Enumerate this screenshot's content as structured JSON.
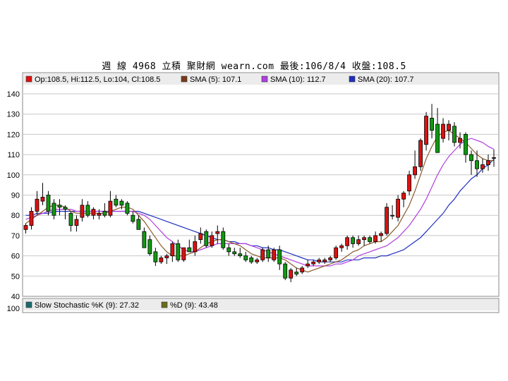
{
  "title": "週 線 4968 立積    聚財網 wearn.com    最後:106/8/4 收盤:108.5",
  "price_legend": [
    {
      "text": "Op:108.5, Hi:112.5, Lo:104, Cl:108.5",
      "color": "#dd1111"
    },
    {
      "text": "SMA (5): 107.1",
      "color": "#7a3a1a"
    },
    {
      "text": "SMA (10): 112.7",
      "color": "#b040e0"
    },
    {
      "text": "SMA (20): 107.7",
      "color": "#2030c0"
    }
  ],
  "stoch_legend": [
    {
      "text": "Slow Stochastic %K (9): 27.32",
      "color": "#1a6b6b"
    },
    {
      "text": "%D (9): 43.48",
      "color": "#6b6b1a"
    }
  ],
  "colors": {
    "up": "#dd1111",
    "down": "#119911",
    "sma5": "#8b5a2b",
    "sma10": "#b040e0",
    "sma20": "#2030c0",
    "grid": "#c8c8c8"
  },
  "chart_data": {
    "type": "candlestick",
    "ylim": [
      40,
      140
    ],
    "yticks": [
      40,
      50,
      60,
      70,
      80,
      90,
      100,
      110,
      120,
      130,
      140
    ],
    "lower_panel_ticks": [
      100
    ],
    "candles": [
      [
        73,
        76,
        71,
        75
      ],
      [
        75,
        84,
        73,
        82
      ],
      [
        82,
        92,
        80,
        88
      ],
      [
        87,
        96,
        85,
        89
      ],
      [
        90,
        92,
        80,
        82
      ],
      [
        86,
        88,
        78,
        80
      ],
      [
        85,
        88,
        80,
        84
      ],
      [
        84,
        85,
        78,
        83
      ],
      [
        81,
        82,
        72,
        75
      ],
      [
        75,
        80,
        72,
        78
      ],
      [
        79,
        88,
        77,
        85
      ],
      [
        85,
        87,
        79,
        80
      ],
      [
        80,
        84,
        78,
        83
      ],
      [
        80,
        83,
        78,
        81
      ],
      [
        82,
        86,
        79,
        80
      ],
      [
        80,
        92,
        79,
        87
      ],
      [
        88,
        90,
        84,
        85
      ],
      [
        87,
        88,
        83,
        85
      ],
      [
        86,
        87,
        80,
        81
      ],
      [
        80,
        82,
        76,
        77
      ],
      [
        78,
        80,
        73,
        73
      ],
      [
        72,
        74,
        64,
        64
      ],
      [
        68,
        70,
        60,
        61
      ],
      [
        62,
        64,
        55,
        57
      ],
      [
        57,
        60,
        56,
        59
      ],
      [
        59,
        61,
        56,
        60
      ],
      [
        60,
        67,
        57,
        66
      ],
      [
        66,
        68,
        57,
        58
      ],
      [
        58,
        64,
        57,
        64
      ],
      [
        64,
        68,
        62,
        62
      ],
      [
        62,
        70,
        60,
        67
      ],
      [
        68,
        74,
        66,
        71
      ],
      [
        72,
        73,
        64,
        65
      ],
      [
        65,
        72,
        64,
        70
      ],
      [
        71,
        75,
        66,
        72
      ],
      [
        72,
        74,
        63,
        64
      ],
      [
        64,
        66,
        60,
        62
      ],
      [
        62,
        64,
        60,
        61
      ],
      [
        61,
        64,
        59,
        60
      ],
      [
        60,
        62,
        57,
        58
      ],
      [
        59,
        60,
        56,
        57
      ],
      [
        57,
        59,
        56,
        58
      ],
      [
        58,
        64,
        57,
        63
      ],
      [
        63,
        65,
        57,
        59
      ],
      [
        58,
        64,
        57,
        63
      ],
      [
        63,
        65,
        53,
        56
      ],
      [
        56,
        57,
        48,
        49
      ],
      [
        49,
        54,
        47,
        53
      ],
      [
        52,
        54,
        50,
        51
      ],
      [
        52,
        55,
        51,
        54
      ],
      [
        55,
        58,
        54,
        56
      ],
      [
        56,
        58,
        55,
        57
      ],
      [
        57,
        59,
        56,
        58
      ],
      [
        57,
        59,
        56,
        58
      ],
      [
        58,
        60,
        57,
        59
      ],
      [
        59,
        65,
        58,
        64
      ],
      [
        64,
        66,
        62,
        65
      ],
      [
        65,
        70,
        63,
        69
      ],
      [
        69,
        70,
        64,
        66
      ],
      [
        66,
        70,
        65,
        68
      ],
      [
        68,
        70,
        65,
        69
      ],
      [
        69,
        70,
        66,
        67
      ],
      [
        67,
        72,
        66,
        70
      ],
      [
        70,
        72,
        67,
        71
      ],
      [
        71,
        86,
        70,
        84
      ],
      [
        80,
        85,
        78,
        80
      ],
      [
        79,
        90,
        77,
        88
      ],
      [
        88,
        92,
        84,
        91
      ],
      [
        92,
        102,
        90,
        100
      ],
      [
        100,
        112,
        98,
        104
      ],
      [
        104,
        118,
        102,
        117
      ],
      [
        115,
        131,
        112,
        129
      ],
      [
        128,
        135,
        118,
        122
      ],
      [
        125,
        133,
        117,
        111
      ],
      [
        118,
        128,
        116,
        125
      ],
      [
        122,
        127,
        117,
        125
      ],
      [
        124,
        126,
        114,
        116
      ],
      [
        116,
        121,
        113,
        118
      ],
      [
        120,
        121,
        106,
        110
      ],
      [
        110,
        112,
        100,
        107
      ],
      [
        107,
        112,
        99,
        103
      ],
      [
        103,
        108,
        101,
        105
      ],
      [
        105,
        110,
        102,
        107
      ],
      [
        108.5,
        112.5,
        104,
        108.5
      ]
    ],
    "sma5": [
      76,
      78,
      80,
      82,
      84,
      85,
      85,
      84,
      82,
      81,
      81,
      81,
      81,
      81,
      81,
      82,
      83,
      84,
      84,
      83,
      80,
      77,
      73,
      69,
      65,
      62,
      60,
      60,
      60,
      61,
      62,
      64,
      66,
      67,
      68,
      68,
      67,
      66,
      65,
      63,
      61,
      60,
      59,
      59,
      59,
      59,
      58,
      56,
      54,
      53,
      52,
      53,
      54,
      55,
      56,
      57,
      58,
      60,
      62,
      63,
      65,
      66,
      67,
      67,
      69,
      72,
      75,
      80,
      85,
      92,
      100,
      108,
      114,
      119,
      121,
      122,
      120,
      118,
      116,
      113,
      110,
      108,
      107,
      107.1
    ],
    "sma10": [
      78,
      79,
      80,
      81,
      82,
      83,
      83,
      83,
      83,
      82,
      82,
      82,
      82,
      82,
      82,
      82,
      82,
      82,
      82,
      82,
      81,
      80,
      78,
      75,
      72,
      69,
      67,
      65,
      63,
      62,
      62,
      63,
      64,
      65,
      66,
      66,
      66,
      66,
      66,
      66,
      65,
      64,
      63,
      62,
      61,
      60,
      59,
      58,
      57,
      56,
      55,
      55,
      55,
      55,
      55,
      56,
      56,
      57,
      58,
      60,
      61,
      62,
      63,
      64,
      65,
      67,
      69,
      72,
      75,
      79,
      83,
      88,
      94,
      100,
      105,
      109,
      112,
      115,
      117,
      118,
      117,
      116,
      114,
      112.7
    ],
    "sma20": [
      80,
      80,
      81,
      81,
      81,
      82,
      82,
      82,
      82,
      82,
      82,
      82,
      82,
      82,
      82,
      82,
      82,
      82,
      82,
      82,
      82,
      81,
      80,
      79,
      78,
      77,
      76,
      75,
      74,
      73,
      72,
      71,
      70,
      69,
      68,
      68,
      67,
      67,
      66,
      66,
      65,
      65,
      64,
      64,
      63,
      63,
      62,
      61,
      60,
      59,
      58,
      58,
      57,
      57,
      57,
      57,
      57,
      58,
      58,
      58,
      59,
      59,
      59,
      60,
      60,
      61,
      62,
      63,
      65,
      67,
      69,
      72,
      75,
      78,
      81,
      85,
      88,
      92,
      95,
      98,
      100,
      103,
      105,
      107.7
    ]
  }
}
